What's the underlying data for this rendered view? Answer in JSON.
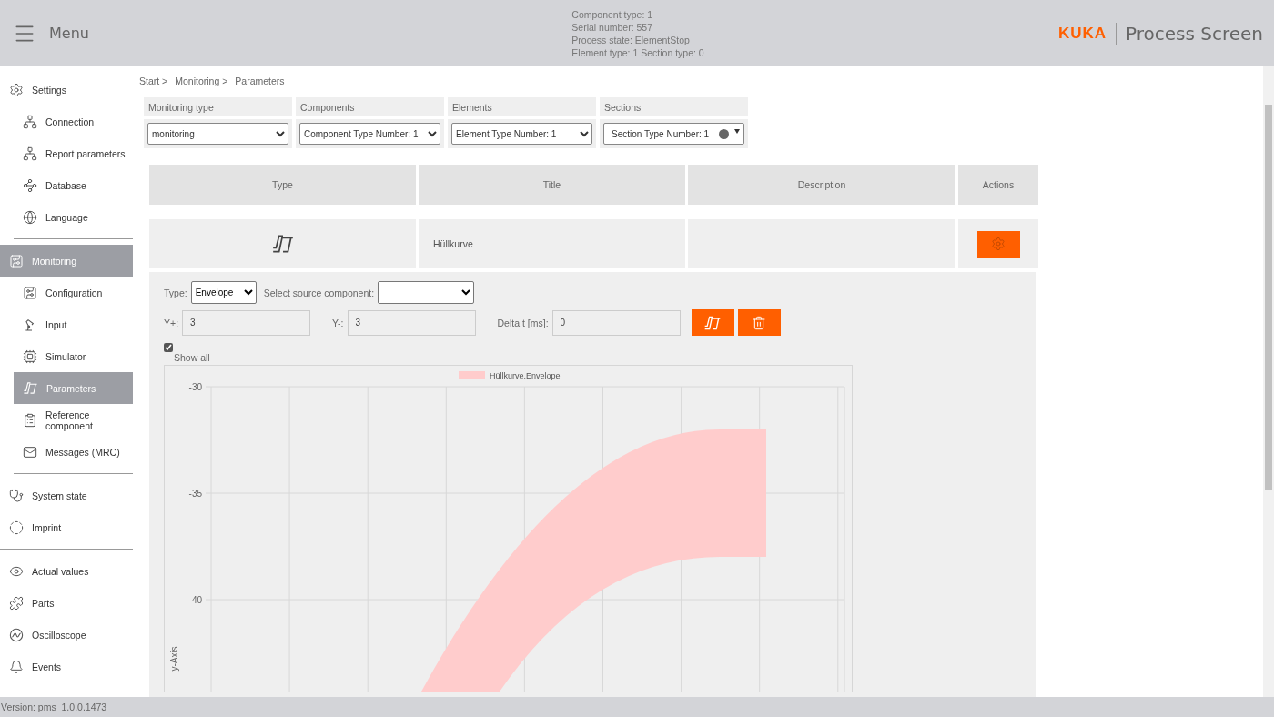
{
  "header": {
    "menu_label": "Menu",
    "info": [
      "Component type: 1",
      "Serial number: 557",
      "Process state: ElementStop",
      "Element type: 1 Section type: 0"
    ],
    "brand": "KUKA",
    "app_title": "Process Screen"
  },
  "sidebar": {
    "groups": [
      {
        "items": [
          {
            "label": "Settings",
            "kind": "top",
            "selected": false
          },
          {
            "label": "Connection",
            "kind": "sub",
            "selected": false
          },
          {
            "label": "Report parameters",
            "kind": "sub",
            "selected": false
          },
          {
            "label": "Database",
            "kind": "sub",
            "selected": false
          },
          {
            "label": "Language",
            "kind": "sub",
            "selected": false
          }
        ]
      },
      {
        "items": [
          {
            "label": "Monitoring",
            "kind": "top",
            "selected": true
          },
          {
            "label": "Configuration",
            "kind": "sub",
            "selected": false
          },
          {
            "label": "Input",
            "kind": "sub",
            "selected": false
          },
          {
            "label": "Simulator",
            "kind": "sub",
            "selected": false
          },
          {
            "label": "Parameters",
            "kind": "sub",
            "selected": true
          },
          {
            "label": "Reference component",
            "kind": "sub",
            "selected": false
          },
          {
            "label": "Messages (MRC)",
            "kind": "sub",
            "selected": false
          }
        ]
      },
      {
        "items": [
          {
            "label": "System state",
            "kind": "top",
            "selected": false
          },
          {
            "label": "Imprint",
            "kind": "top",
            "selected": false
          }
        ]
      },
      {
        "items": [
          {
            "label": "Actual values",
            "kind": "top",
            "selected": false
          },
          {
            "label": "Parts",
            "kind": "top",
            "selected": false
          },
          {
            "label": "Oscilloscope",
            "kind": "top",
            "selected": false
          },
          {
            "label": "Events",
            "kind": "top",
            "selected": false
          }
        ]
      }
    ]
  },
  "breadcrumb": [
    "Start >",
    "Monitoring >",
    "Parameters"
  ],
  "filters": [
    {
      "label": "Monitoring type",
      "value": "monitoring",
      "kind": "select"
    },
    {
      "label": "Components",
      "value": "Component Type Number: 1",
      "kind": "select"
    },
    {
      "label": "Elements",
      "value": "Element Type Number: 1",
      "kind": "select"
    },
    {
      "label": "Sections",
      "value": "Section Type Number: 1",
      "kind": "dot-select"
    }
  ],
  "table": {
    "columns": [
      "Type",
      "Title",
      "Description",
      "Actions"
    ],
    "rows": [
      {
        "title": "Hüllkurve"
      }
    ]
  },
  "detail": {
    "type_label": "Type:",
    "type_value": "Envelope",
    "source_label": "Select source component:",
    "fields": [
      {
        "label": "Y+:",
        "value": "3"
      },
      {
        "label": "Y-:",
        "value": "3"
      },
      {
        "label": "Delta t [ms]:",
        "value": "0"
      }
    ],
    "show_all": {
      "label": "Show all",
      "checked": true
    },
    "chart": {
      "legend": "Hüllkurve.Envelope",
      "ylabel": "y-Axis",
      "yticks": [
        "-30",
        "-35",
        "-40"
      ]
    }
  },
  "status_bar": "Version: pms_1.0.0.1473"
}
